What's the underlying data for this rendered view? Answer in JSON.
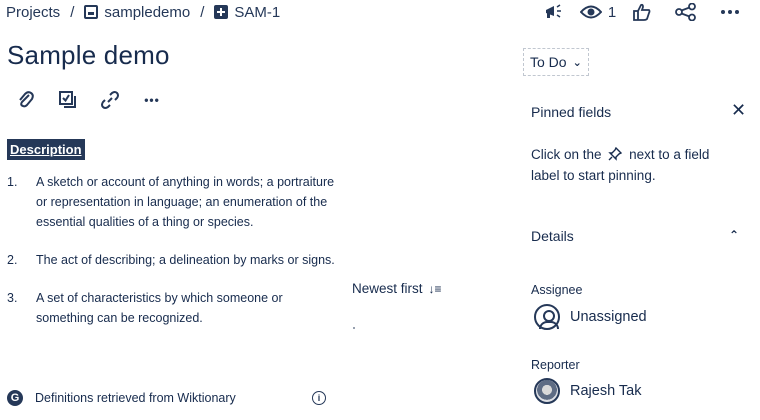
{
  "breadcrumb": {
    "projects": "Projects",
    "separator": "/",
    "project_name": "sampledemo",
    "issue_key": "SAM-1"
  },
  "top_actions": {
    "watch_count": "1",
    "icons": [
      "megaphone-icon",
      "eye-icon",
      "thumbs-up-icon",
      "share-icon",
      "more-icon"
    ]
  },
  "issue": {
    "title": "Sample demo",
    "tools": [
      "attachment-icon",
      "child-issue-icon",
      "link-icon",
      "more-icon"
    ],
    "tool_more": "•••"
  },
  "description": {
    "heading": "Description",
    "items": [
      {
        "num": "1.",
        "text": "A sketch or account of anything in words; a portraiture or representation in language; an enumeration of the essential qualities of a thing or species."
      },
      {
        "num": "2.",
        "text": "The act of describing; a delineation by marks or signs."
      },
      {
        "num": "3.",
        "text": "A set of characteristics by which someone or something can be recognized."
      }
    ],
    "source": "Definitions retrieved from Wiktionary",
    "source_icon": "G"
  },
  "activity": {
    "sort_label": "Newest first",
    "sort_icon": "↓≡"
  },
  "status": {
    "value": "To Do"
  },
  "pinned": {
    "title": "Pinned fields",
    "hint_before": "Click on the",
    "hint_after": "next to a field label to start pinning."
  },
  "details": {
    "title": "Details",
    "assignee_label": "Assignee",
    "assignee_value": "Unassigned",
    "reporter_label": "Reporter",
    "reporter_value": "Rajesh Tak"
  },
  "colors": {
    "text": "#172b4d",
    "icon": "#253858",
    "description_highlight": "#253858"
  }
}
